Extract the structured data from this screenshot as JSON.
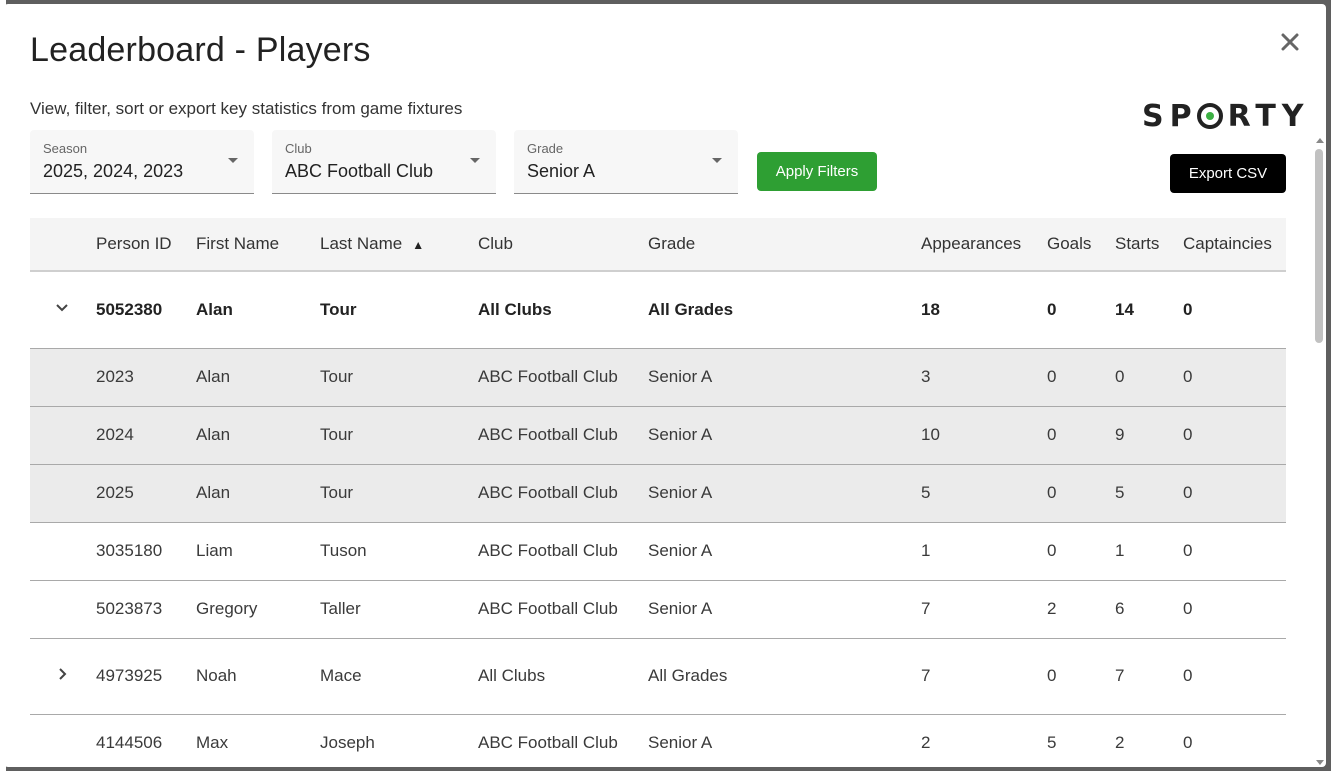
{
  "modal": {
    "title": "Leaderboard - Players",
    "subtitle": "View, filter, sort or export key statistics from game fixtures",
    "logo_text_left": "SP",
    "logo_text_right": "RTY"
  },
  "filters": {
    "season": {
      "label": "Season",
      "value": "2025, 2024, 2023"
    },
    "club": {
      "label": "Club",
      "value": "ABC Football Club"
    },
    "grade": {
      "label": "Grade",
      "value": "Senior A"
    },
    "apply_label": "Apply Filters",
    "export_label": "Export CSV"
  },
  "colors": {
    "apply": "#2e9f33",
    "export": "#000000",
    "logo_dot": "#3cb043"
  },
  "table": {
    "columns": {
      "person_id": "Person ID",
      "first_name": "First Name",
      "last_name": "Last Name",
      "sort_indicator": "▲",
      "club": "Club",
      "grade": "Grade",
      "appearances": "Appearances",
      "goals": "Goals",
      "starts": "Starts",
      "captaincies": "Captaincies"
    },
    "rows": [
      {
        "kind": "group-expanded",
        "icon": "chevron-down-icon",
        "person_id": "5052380",
        "first_name": "Alan",
        "last_name": "Tour",
        "club": "All Clubs",
        "grade": "All Grades",
        "appearances": "18",
        "goals": "0",
        "starts": "14",
        "captaincies": "0"
      },
      {
        "kind": "sub",
        "person_id": "2023",
        "first_name": "Alan",
        "last_name": "Tour",
        "club": "ABC Football Club",
        "grade": "Senior A",
        "appearances": "3",
        "goals": "0",
        "starts": "0",
        "captaincies": "0"
      },
      {
        "kind": "sub",
        "person_id": "2024",
        "first_name": "Alan",
        "last_name": "Tour",
        "club": "ABC Football Club",
        "grade": "Senior A",
        "appearances": "10",
        "goals": "0",
        "starts": "9",
        "captaincies": "0"
      },
      {
        "kind": "sub",
        "person_id": "2025",
        "first_name": "Alan",
        "last_name": "Tour",
        "club": "ABC Football Club",
        "grade": "Senior A",
        "appearances": "5",
        "goals": "0",
        "starts": "5",
        "captaincies": "0"
      },
      {
        "kind": "plain",
        "person_id": "3035180",
        "first_name": "Liam",
        "last_name": "Tuson",
        "club": "ABC Football Club",
        "grade": "Senior A",
        "appearances": "1",
        "goals": "0",
        "starts": "1",
        "captaincies": "0"
      },
      {
        "kind": "plain",
        "person_id": "5023873",
        "first_name": "Gregory",
        "last_name": "Taller",
        "club": "ABC Football Club",
        "grade": "Senior A",
        "appearances": "7",
        "goals": "2",
        "starts": "6",
        "captaincies": "0"
      },
      {
        "kind": "group-collapsed",
        "icon": "chevron-right-icon",
        "person_id": "4973925",
        "first_name": "Noah",
        "last_name": "Mace",
        "club": "All Clubs",
        "grade": "All Grades",
        "appearances": "7",
        "goals": "0",
        "starts": "7",
        "captaincies": "0"
      },
      {
        "kind": "plain",
        "person_id": "4144506",
        "first_name": "Max",
        "last_name": "Joseph",
        "club": "ABC Football Club",
        "grade": "Senior A",
        "appearances": "2",
        "goals": "5",
        "starts": "2",
        "captaincies": "0"
      }
    ]
  }
}
